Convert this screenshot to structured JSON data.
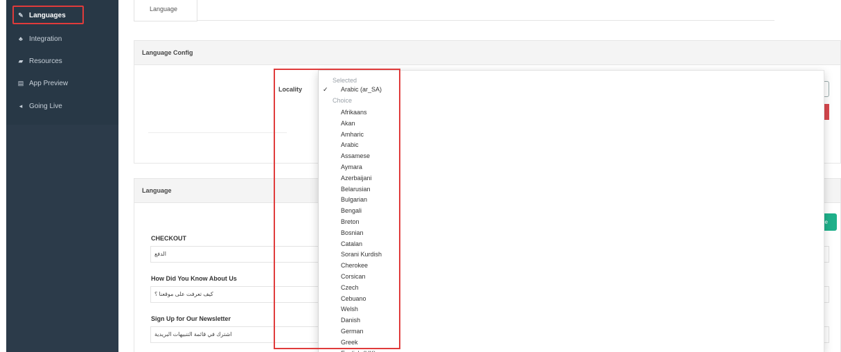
{
  "sidebar": {
    "items": [
      {
        "label": "Languages",
        "icon": "language-icon",
        "glyph": "✎",
        "active": true
      },
      {
        "label": "Integration",
        "icon": "plug-icon",
        "glyph": "♣",
        "active": false
      },
      {
        "label": "Resources",
        "icon": "resources-icon",
        "glyph": "▰",
        "active": false
      },
      {
        "label": "App Preview",
        "icon": "preview-icon",
        "glyph": "▤",
        "active": false
      },
      {
        "label": "Going Live",
        "icon": "megaphone-icon",
        "glyph": "◂",
        "active": false
      }
    ]
  },
  "tabs": [
    {
      "label": "Language"
    }
  ],
  "config_panel": {
    "title": "Language Config",
    "locality_label": "Locality"
  },
  "side_buttons": {
    "green_label": "ne"
  },
  "language_panel": {
    "title": "Language",
    "fields": [
      {
        "label": "CHECKOUT",
        "value": "الدفع"
      },
      {
        "label": "How Did You Know About Us",
        "value": "كيف تعرفت على موقعنا ؟"
      },
      {
        "label": "Sign Up for Our Newsletter",
        "value": "اشترك في قائمة التنبيهات البريدية"
      }
    ]
  },
  "dropdown": {
    "selected_header": "Selected",
    "check_glyph": "✓",
    "selected_value": "Arabic (ar_SA)",
    "choice_header": "Choice",
    "options": [
      "Afrikaans",
      "Akan",
      "Amharic",
      "Arabic",
      "Assamese",
      "Aymara",
      "Azerbaijani",
      "Belarusian",
      "Bulgarian",
      "Bengali",
      "Breton",
      "Bosnian",
      "Catalan",
      "Sorani Kurdish",
      "Cherokee",
      "Corsican",
      "Czech",
      "Cebuano",
      "Welsh",
      "Danish",
      "German",
      "Greek",
      "English (UK)"
    ]
  },
  "colors": {
    "sidebar": "#2e3d4d",
    "highlight": "#e03b3b",
    "danger": "#d8484e",
    "success": "#1fb08a"
  }
}
